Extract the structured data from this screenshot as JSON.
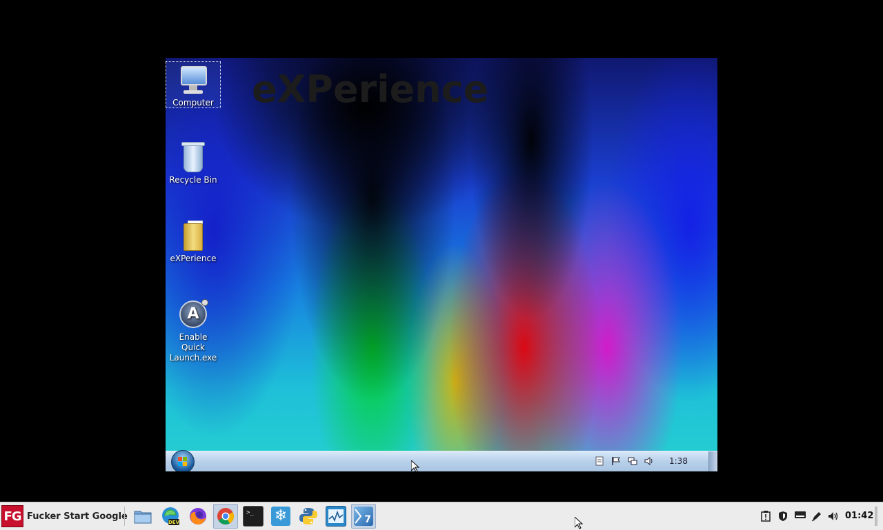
{
  "vm": {
    "watermark": "eXPerience",
    "desktop_icons": [
      {
        "label": "Computer",
        "icon": "computer-icon",
        "selected": true
      },
      {
        "label": "Recycle Bin",
        "icon": "recycle-bin-icon",
        "selected": false
      },
      {
        "label": "eXPerience",
        "icon": "folder-icon",
        "selected": false
      },
      {
        "label": "Enable Quick Launch.exe",
        "icon": "autoit-app-icon",
        "selected": false
      }
    ],
    "taskbar": {
      "start_icon": "windows-orb-icon",
      "tray_icons": [
        "document-icon",
        "action-center-flag-icon",
        "network-icon",
        "volume-icon"
      ],
      "clock": "1:38"
    }
  },
  "host_taskbar": {
    "start_logo": "FG",
    "start_label": "Fucker Start Google",
    "launchers": [
      {
        "name": "file-manager",
        "icon": "folder-icon",
        "active": false
      },
      {
        "name": "edge-dev",
        "icon": "edge-dev-icon",
        "badge": "DEV",
        "active": false
      },
      {
        "name": "firefox",
        "icon": "firefox-icon",
        "active": false
      },
      {
        "name": "chrome",
        "icon": "chrome-icon",
        "active": true
      },
      {
        "name": "terminal",
        "icon": "terminal-icon",
        "glyph": ">_",
        "active": false
      },
      {
        "name": "snowflake-app",
        "icon": "snowflake-icon",
        "glyph": "❄",
        "active": false
      },
      {
        "name": "python",
        "icon": "python-icon",
        "active": false
      },
      {
        "name": "system-monitor",
        "icon": "system-monitor-icon",
        "active": false
      },
      {
        "name": "windows-7-vm",
        "icon": "windows-7-vm-icon",
        "glyph": "7",
        "active": true
      }
    ],
    "tray_icons": [
      "clipboard-alert-icon",
      "shield-icon",
      "keyboard-icon",
      "pen-icon",
      "speaker-icon"
    ],
    "clock": "01:42"
  },
  "colors": {
    "host_taskbar_bg": "#ececec",
    "vm_taskbar_bg": "#b8d0ea",
    "start_logo_red": "#c8102e"
  }
}
